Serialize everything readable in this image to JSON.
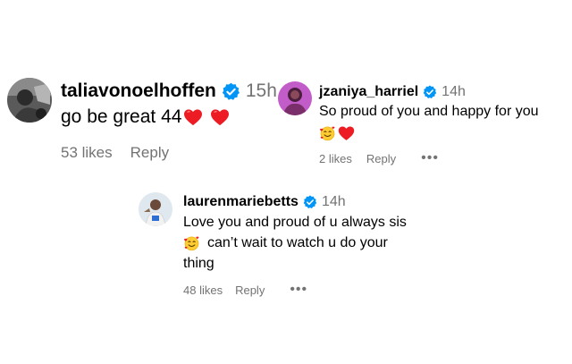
{
  "colors": {
    "verified_badge": "#0095f6",
    "secondary_text": "#737373",
    "heart": "#ed1c24"
  },
  "comments": [
    {
      "username": "taliavonoelhoffen",
      "verified": true,
      "time": "15h",
      "lines": [
        "go be great 44"
      ],
      "emojis": [
        "red-heart",
        "red-heart"
      ],
      "likes": "53 likes",
      "reply": "Reply"
    },
    {
      "username": "jzaniya_harriel",
      "verified": true,
      "time": "14h",
      "lines": [
        "So proud of you and happy for you"
      ],
      "emojis": [
        "smiling-face-with-hearts",
        "red-heart"
      ],
      "likes": "2 likes",
      "reply": "Reply",
      "more": "•••"
    },
    {
      "username": "laurenmariebetts",
      "verified": true,
      "time": "14h",
      "lines": [
        "Love you and proud of u always sis",
        "can’t wait to watch u do your",
        "thing"
      ],
      "emojis": [
        "smiling-face-with-hearts"
      ],
      "likes": "48 likes",
      "reply": "Reply",
      "more": "•••"
    }
  ]
}
